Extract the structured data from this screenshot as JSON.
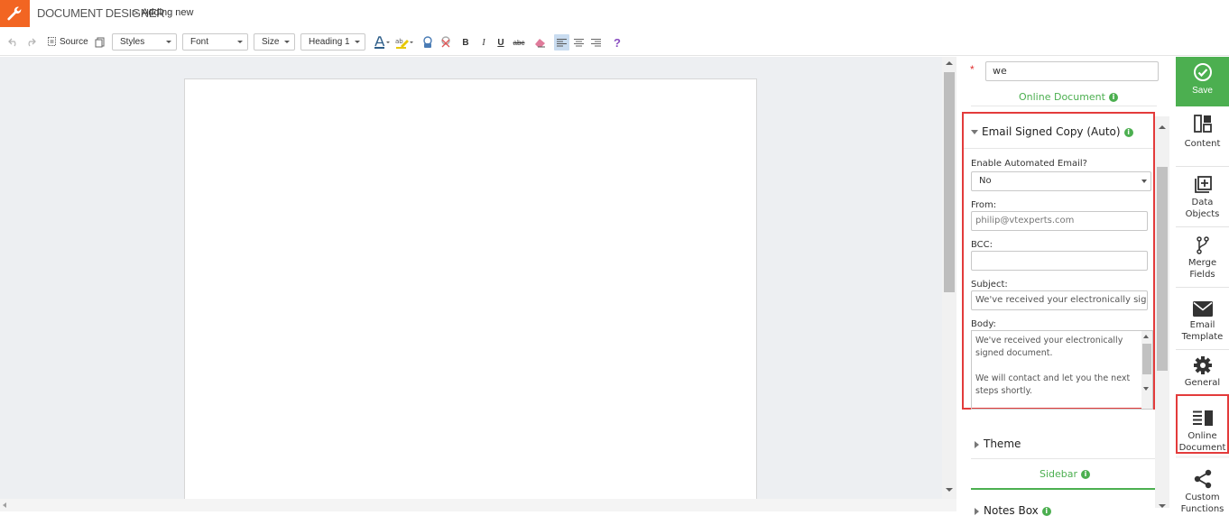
{
  "header": {
    "app_title": "DOCUMENT DESIGNER",
    "breadcrumb_separator": ">",
    "page_title": "Adding new"
  },
  "toolbar": {
    "source_label": "Source",
    "styles_label": "Styles",
    "font_label": "Font",
    "size_label": "Size",
    "format_label": "Heading 1",
    "help_label": "?",
    "bold_label": "B",
    "italic_label": "I",
    "underline_label": "U",
    "strike_label": "abc"
  },
  "panel": {
    "name_value": "we",
    "required_mark": "*",
    "online_document_label": "Online Document",
    "info_glyph": "i",
    "email_section": {
      "title": "Email Signed Copy (Auto)",
      "enable_label": "Enable Automated Email?",
      "enable_value": "No",
      "from_label": "From:",
      "from_placeholder": "philip@vtexperts.com",
      "bcc_label": "BCC:",
      "bcc_value": "",
      "subject_label": "Subject:",
      "subject_value": "We've received your electronically signed document",
      "body_label": "Body:",
      "body_line1": "We've received your electronically signed document.",
      "body_line2": "We will contact and let you the next steps shortly."
    },
    "theme_label": "Theme",
    "sidebar_label": "Sidebar",
    "notes_box_label": "Notes Box"
  },
  "rail": {
    "save": "Save",
    "content": "Content",
    "data_objects_1": "Data",
    "data_objects_2": "Objects",
    "merge_fields_1": "Merge",
    "merge_fields_2": "Fields",
    "email_template_1": "Email",
    "email_template_2": "Template",
    "general": "General",
    "online_document_1": "Online",
    "online_document_2": "Document",
    "custom_functions_1": "Custom",
    "custom_functions_2": "Functions"
  },
  "colors": {
    "brand_orange": "#f26522",
    "accent_green": "#4caf50",
    "highlight_red": "#e33b3b"
  }
}
